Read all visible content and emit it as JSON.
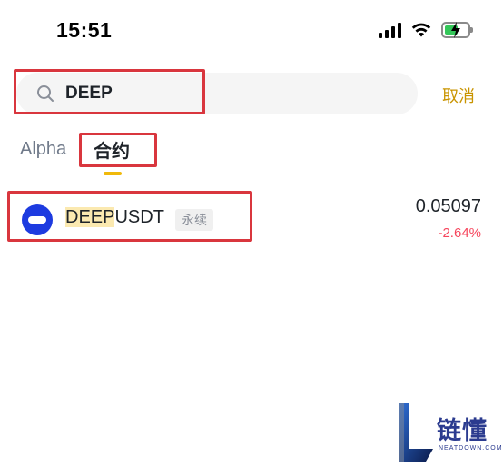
{
  "status_bar": {
    "time": "15:51",
    "icons": [
      "signal-icon",
      "wifi-icon",
      "battery-charging-icon"
    ]
  },
  "search": {
    "value": "DEEP",
    "cancel_label": "取消",
    "icon": "search-icon"
  },
  "tabs": [
    {
      "label": "Alpha",
      "active": false
    },
    {
      "label": "合约",
      "active": true
    }
  ],
  "results": [
    {
      "symbol_highlight": "DEEP",
      "symbol_rest": "USDT",
      "tag": "永续",
      "price": "0.05097",
      "change": "-2.64%",
      "logo": "deep-coin-logo"
    }
  ],
  "watermark": {
    "brand": "链懂",
    "sub": "NEATDOWN.COM"
  },
  "colors": {
    "accent": "#f0b90b",
    "cancel": "#c99400",
    "negative": "#f6465d",
    "annotation": "#d9363e",
    "logo_blue": "#1d3be0"
  }
}
